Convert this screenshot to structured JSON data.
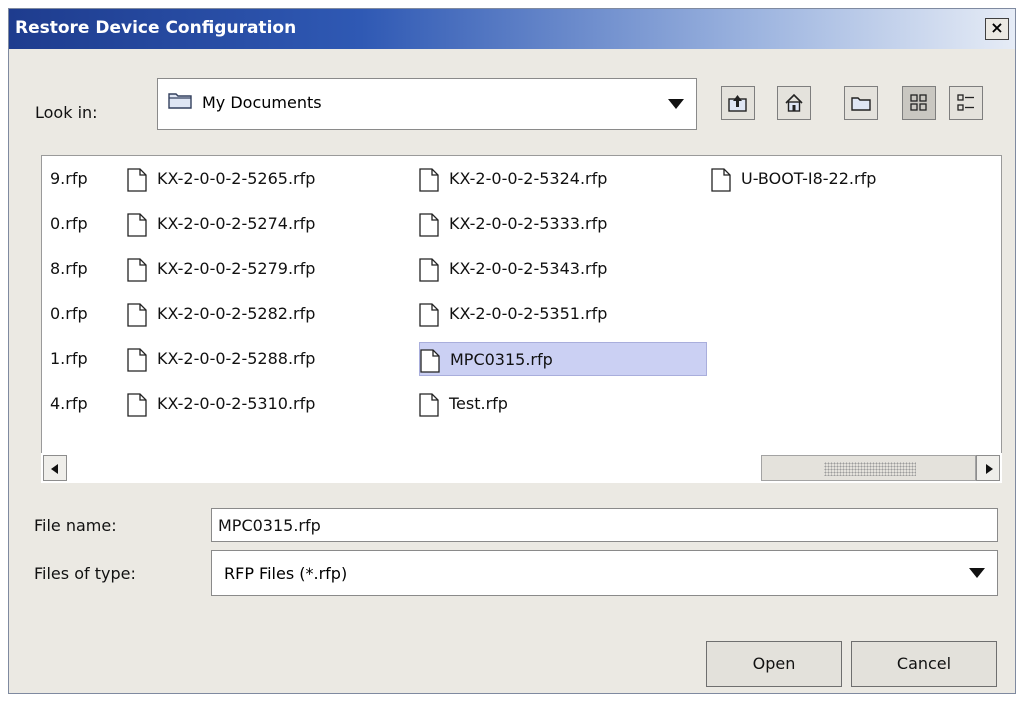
{
  "dialog": {
    "title": "Restore Device Configuration",
    "close_symbol": "×"
  },
  "look_in": {
    "label": "Look in:",
    "value": "My Documents"
  },
  "toolbar": [
    "up-one-level-icon",
    "home-icon",
    "new-folder-icon",
    "list-view-icon",
    "details-view-icon"
  ],
  "files": [
    {
      "name": "9.rfp",
      "selected": false
    },
    {
      "name": "0.rfp",
      "selected": false
    },
    {
      "name": "8.rfp",
      "selected": false
    },
    {
      "name": "0.rfp",
      "selected": false
    },
    {
      "name": "1.rfp",
      "selected": false
    },
    {
      "name": "4.rfp",
      "selected": false
    },
    {
      "name": "KX-2-0-0-2-5265.rfp",
      "selected": false
    },
    {
      "name": "KX-2-0-0-2-5274.rfp",
      "selected": false
    },
    {
      "name": "KX-2-0-0-2-5279.rfp",
      "selected": false
    },
    {
      "name": "KX-2-0-0-2-5282.rfp",
      "selected": false
    },
    {
      "name": "KX-2-0-0-2-5288.rfp",
      "selected": false
    },
    {
      "name": "KX-2-0-0-2-5310.rfp",
      "selected": false
    },
    {
      "name": "KX-2-0-0-2-5324.rfp",
      "selected": false
    },
    {
      "name": "KX-2-0-0-2-5333.rfp",
      "selected": false
    },
    {
      "name": "KX-2-0-0-2-5343.rfp",
      "selected": false
    },
    {
      "name": "KX-2-0-0-2-5351.rfp",
      "selected": false
    },
    {
      "name": "MPC0315.rfp",
      "selected": true
    },
    {
      "name": "Test.rfp",
      "selected": false
    },
    {
      "name": "U-BOOT-I8-22.rfp",
      "selected": false
    }
  ],
  "file_name": {
    "label": "File name:",
    "value": "MPC0315.rfp"
  },
  "file_type": {
    "label": "Files of type:",
    "value": "RFP Files (*.rfp)"
  },
  "buttons": {
    "open": "Open",
    "cancel": "Cancel"
  },
  "colors": {
    "title_bar": "#2f59b4",
    "selection": "#cbd0f3"
  }
}
